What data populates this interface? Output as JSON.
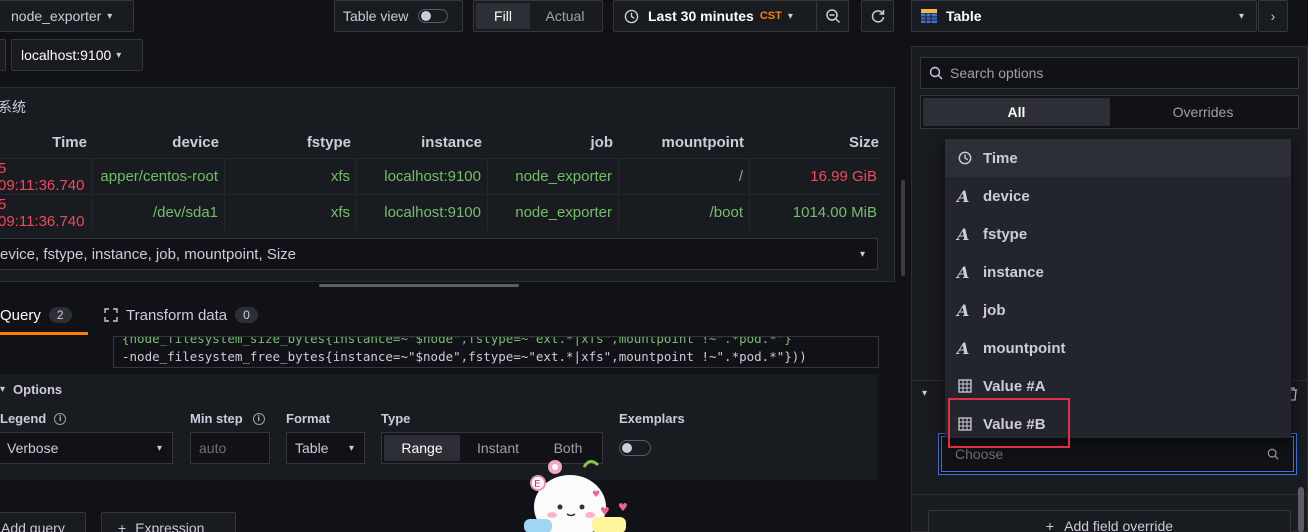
{
  "topbar": {
    "datasource": "node_exporter",
    "table_view_label": "Table view",
    "fill_label": "Fill",
    "actual_label": "Actual",
    "time_range": "Last 30 minutes",
    "timezone": "CST",
    "viz_type": "Table"
  },
  "variable": {
    "value": "localhost:9100"
  },
  "panel": {
    "title": "系统",
    "columns": [
      "Time",
      "device",
      "fstype",
      "instance",
      "job",
      "mountpoint",
      "Size"
    ],
    "rows": [
      [
        "5 09:11:36.740",
        "apper/centos-root",
        "xfs",
        "localhost:9100",
        "node_exporter",
        "/",
        "16.99 GiB"
      ],
      [
        "5 09:11:36.740",
        "/dev/sda1",
        "xfs",
        "localhost:9100",
        "node_exporter",
        "/boot",
        "1014.00 MiB"
      ]
    ],
    "footer_select": "evice, fstype, instance, job, mountpoint, Size"
  },
  "editor": {
    "tab_query": "Query",
    "query_count": "2",
    "tab_transform": "Transform data",
    "transform_count": "0",
    "code_line1": "{node_filesystem_size_bytes{instance=~\"$node\",fstype=~\"ext.*|xfs\",mountpoint !~\".*pod.*\"}",
    "code_line2": "-node_filesystem_free_bytes{instance=~\"$node\",fstype=~\"ext.*|xfs\",mountpoint !~\".*pod.*\"}))",
    "options_label": "Options",
    "legend_label": "Legend",
    "legend_value": "Verbose",
    "minstep_label": "Min step",
    "minstep_placeholder": "auto",
    "format_label": "Format",
    "format_value": "Table",
    "type_label": "Type",
    "type_range": "Range",
    "type_instant": "Instant",
    "type_both": "Both",
    "exemplars_label": "Exemplars",
    "add_query": "Add query",
    "expression": "Expression"
  },
  "options_pane": {
    "search_placeholder": "Search options",
    "tab_all": "All",
    "tab_overrides": "Overrides",
    "choose_placeholder": "Choose",
    "add_override": "Add field override"
  },
  "field_dropdown": {
    "items": [
      {
        "label": "Time",
        "icon": "clock-icon"
      },
      {
        "label": "device",
        "icon": "text-field-icon"
      },
      {
        "label": "fstype",
        "icon": "text-field-icon"
      },
      {
        "label": "instance",
        "icon": "text-field-icon"
      },
      {
        "label": "job",
        "icon": "text-field-icon"
      },
      {
        "label": "mountpoint",
        "icon": "text-field-icon"
      },
      {
        "label": "Value #A",
        "icon": "table-field-icon"
      },
      {
        "label": "Value #B",
        "icon": "table-field-icon"
      }
    ],
    "highlight_color": "#e02f44"
  },
  "colors": {
    "accent": "#3d71d9",
    "green": "#73bf69",
    "red": "#f2495c",
    "orange": "#ff7f00"
  }
}
